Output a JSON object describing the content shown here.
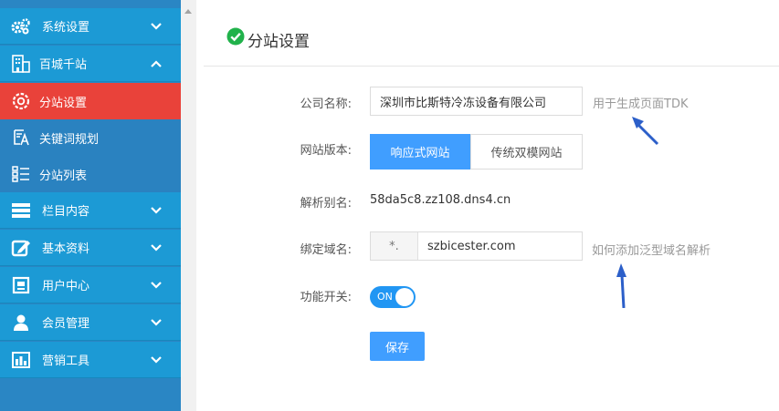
{
  "sidebar": {
    "items": [
      {
        "label": "系统设置",
        "icon": "gears-icon"
      },
      {
        "label": "百城千站",
        "icon": "building-icon"
      },
      {
        "label": "分站设置",
        "icon": "gear-icon"
      },
      {
        "label": "关键词规划",
        "icon": "keyword-icon"
      },
      {
        "label": "分站列表",
        "icon": "list-icon"
      },
      {
        "label": "栏目内容",
        "icon": "columns-icon"
      },
      {
        "label": "基本资料",
        "icon": "edit-icon"
      },
      {
        "label": "用户中心",
        "icon": "id-card-icon"
      },
      {
        "label": "会员管理",
        "icon": "user-icon"
      },
      {
        "label": "营销工具",
        "icon": "bar-chart-icon"
      }
    ]
  },
  "page": {
    "title": "分站设置",
    "title_icon": "check-circle-icon"
  },
  "form": {
    "company": {
      "label": "公司名称:",
      "value": "深圳市比斯特冷冻设备有限公司",
      "hint": "用于生成页面TDK"
    },
    "version": {
      "label": "网站版本:",
      "options": [
        "响应式网站",
        "传统双模网站"
      ],
      "selected": "响应式网站"
    },
    "alias": {
      "label": "解析别名:",
      "value": "58da5c8.zz108.dns4.cn"
    },
    "domain": {
      "label": "绑定域名:",
      "prefix": "*.",
      "value": "szbicester.com",
      "hint": "如何添加泛型域名解析"
    },
    "switch": {
      "label": "功能开关:",
      "state": "ON"
    },
    "save_label": "保存"
  },
  "colors": {
    "sidebar_top": "#1c9ad5",
    "sidebar_sub": "#2a82c0",
    "active": "#e9423a",
    "primary": "#409eff",
    "toggle": "#2196f3",
    "arrow": "#2c5fc9",
    "check": "#21b24b"
  }
}
